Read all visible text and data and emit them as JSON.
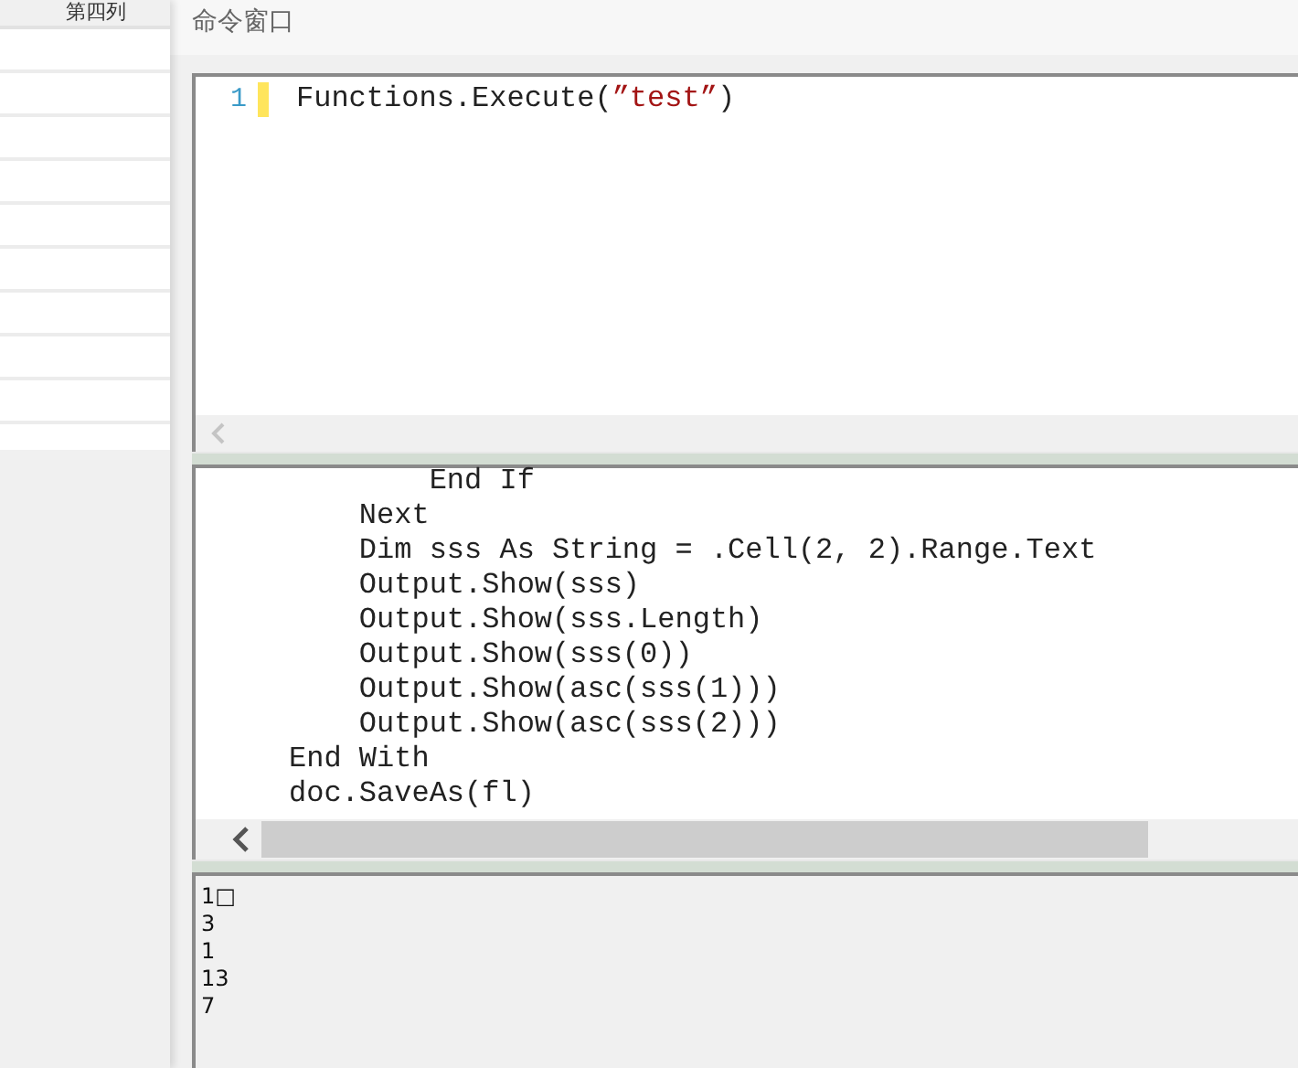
{
  "grid": {
    "header": "第四列"
  },
  "command_window": {
    "title": "命令窗口",
    "editor": {
      "lines": [
        {
          "number": "1",
          "tokens": [
            {
              "kind": "plain",
              "text": "Functions.Execute("
            },
            {
              "kind": "string",
              "text": "”test”"
            },
            {
              "kind": "plain",
              "text": ")"
            }
          ]
        }
      ]
    },
    "code": {
      "lines": [
        "        End If",
        "    Next",
        "    Dim sss As String = .Cell(2, 2).Range.Text",
        "    Output.Show(sss)",
        "    Output.Show(sss.Length)",
        "    Output.Show(sss(0))",
        "    Output.Show(asc(sss(1)))",
        "    Output.Show(asc(sss(2)))",
        "End With",
        "doc.SaveAs(fl)"
      ]
    },
    "output": {
      "lines": [
        "1□",
        "3",
        "1",
        "13",
        "7"
      ]
    }
  }
}
